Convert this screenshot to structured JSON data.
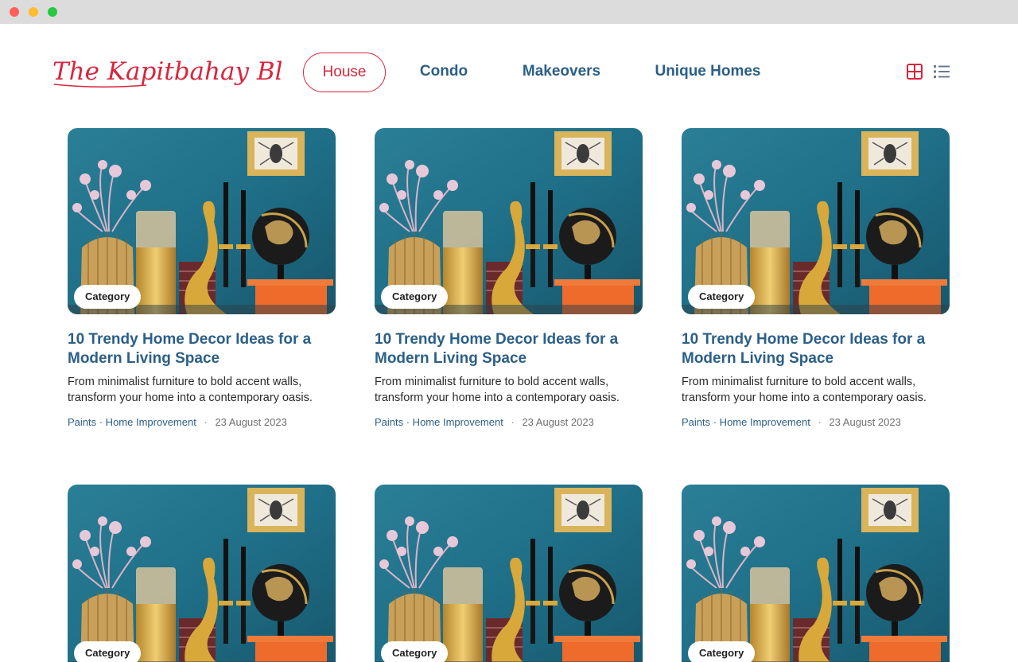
{
  "window": {
    "controls": [
      "close",
      "minimize",
      "maximize"
    ]
  },
  "brand": {
    "logo_text": "The Kapitbahay Blog",
    "color": "#d7263d"
  },
  "nav": {
    "items": [
      {
        "label": "House",
        "active": true
      },
      {
        "label": "Condo",
        "active": false
      },
      {
        "label": "Makeovers",
        "active": false
      },
      {
        "label": "Unique Homes",
        "active": false
      }
    ],
    "active_color": "#d7263d",
    "link_color": "#2b5f88"
  },
  "view_toggle": {
    "grid_icon": "grid-view-icon",
    "list_icon": "list-view-icon",
    "selected": "grid"
  },
  "posts": [
    {
      "category": "Category",
      "title_line1": "10 Trendy Home Decor Ideas for a",
      "title_line2": "Modern Living Space",
      "desc_line1": "From minimalist furniture to bold accent walls,",
      "desc_line2": "transform your home into a contemporary oasis.",
      "tags": "Paints · Home Improvement",
      "separator": "·",
      "date": "23 August 2023"
    },
    {
      "category": "Category",
      "title_line1": "10 Trendy Home Decor Ideas for a",
      "title_line2": "Modern Living Space",
      "desc_line1": "From minimalist furniture to bold accent walls,",
      "desc_line2": "transform your home into a contemporary oasis.",
      "tags": "Paints · Home Improvement",
      "separator": "·",
      "date": "23 August 2023"
    },
    {
      "category": "Category",
      "title_line1": "10 Trendy Home Decor Ideas for a",
      "title_line2": "Modern Living Space",
      "desc_line1": "From minimalist furniture to bold accent walls,",
      "desc_line2": "transform your home into a contemporary oasis.",
      "tags": "Paints · Home Improvement",
      "separator": "·",
      "date": "23 August 2023"
    },
    {
      "category": "Category"
    },
    {
      "category": "Category"
    },
    {
      "category": "Category"
    }
  ]
}
